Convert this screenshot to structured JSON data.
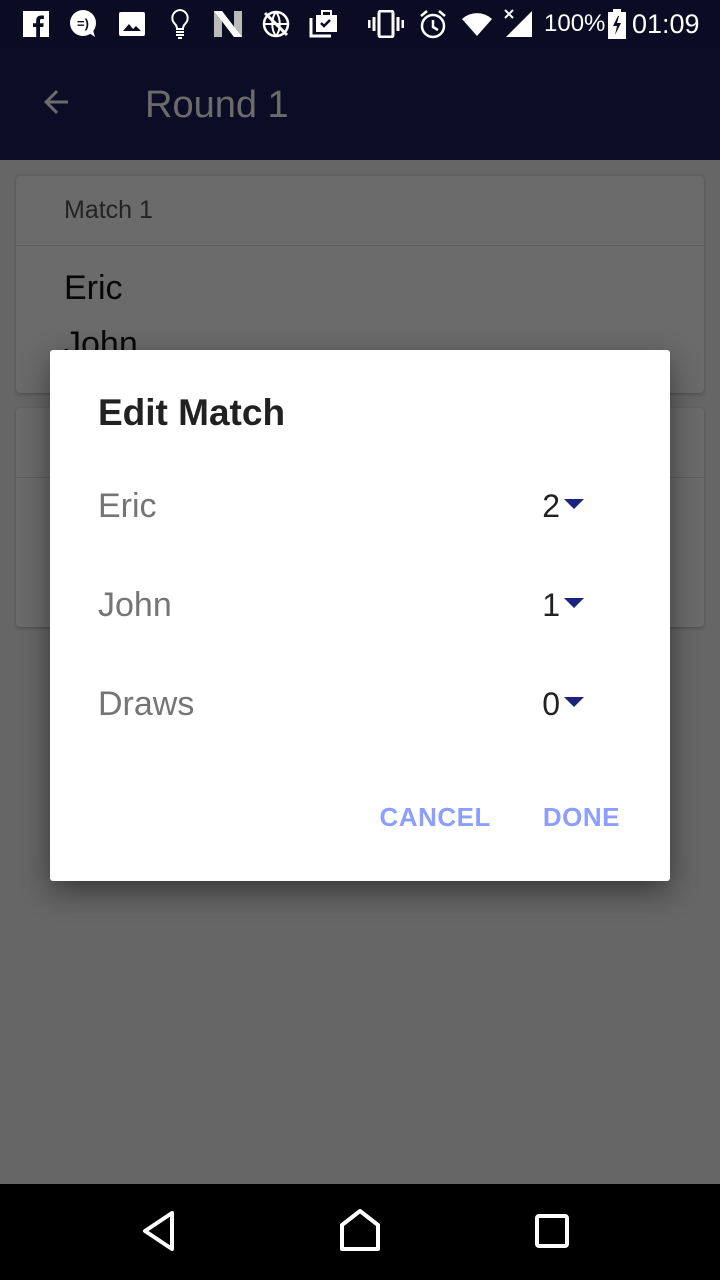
{
  "status_bar": {
    "left_icons": [
      "facebook-icon",
      "messenger-smiley-icon",
      "image-icon",
      "lightbulb-icon",
      "n-app-icon",
      "globe-blocked-icon",
      "briefcase-check-icon"
    ],
    "right_icons": [
      "vibrate-icon",
      "alarm-icon",
      "wifi-icon",
      "signal-no-data-icon"
    ],
    "battery_percent": "100%",
    "battery_icon": "battery-charging-icon",
    "time": "01:09"
  },
  "app_bar": {
    "back_icon": "arrow-back-icon",
    "title": "Round 1"
  },
  "background_cards": [
    {
      "header": "Match 1",
      "players": [
        "Eric",
        "John"
      ]
    },
    {
      "header": "",
      "players": []
    }
  ],
  "dialog": {
    "title": "Edit Match",
    "rows": [
      {
        "label": "Eric",
        "value": "2"
      },
      {
        "label": "John",
        "value": "1"
      },
      {
        "label": "Draws",
        "value": "0"
      }
    ],
    "cancel_label": "CANCEL",
    "done_label": "DONE"
  },
  "nav_bar": {
    "back": "nav-back-icon",
    "home": "nav-home-icon",
    "recents": "nav-recents-icon"
  },
  "colors": {
    "status_bar": "#0b0b24",
    "app_bar": "#1a1f5a",
    "accent_button": "#8c9eff",
    "spinner_caret": "#1a237e"
  }
}
